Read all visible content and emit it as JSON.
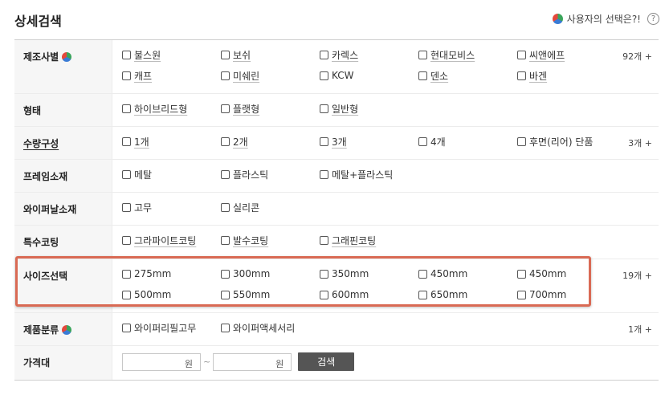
{
  "header": {
    "title": "상세검색",
    "user_choice_label": "사용자의 선택은?!",
    "help_glyph": "?"
  },
  "filters": [
    {
      "label": "제조사별",
      "options": [
        "불스원",
        "보쉬",
        "카렉스",
        "현대모비스",
        "씨앤에프",
        "캐프",
        "미쉐린",
        "KCW",
        "덴소",
        "바겐"
      ],
      "count": "92개 +"
    },
    {
      "label": "형태",
      "options": [
        "하이브리드형",
        "플랫형",
        "일반형"
      ],
      "count": ""
    },
    {
      "label": "수량구성",
      "options": [
        "1개",
        "2개",
        "3개",
        "4개",
        "후면(리어) 단품"
      ],
      "count": "3개 +"
    },
    {
      "label": "프레임소재",
      "options": [
        "메탈",
        "플라스틱",
        "메탈+플라스틱"
      ],
      "count": ""
    },
    {
      "label": "와이퍼날소재",
      "options": [
        "고무",
        "실리콘"
      ],
      "count": ""
    },
    {
      "label": "특수코팅",
      "options": [
        "그라파이트코팅",
        "발수코팅",
        "그래핀코팅"
      ],
      "count": ""
    },
    {
      "label": "사이즈선택",
      "options": [
        "275mm",
        "300mm",
        "350mm",
        "450mm",
        "450mm",
        "500mm",
        "550mm",
        "600mm",
        "650mm",
        "700mm"
      ],
      "count": "19개 +"
    },
    {
      "label": "제품분류",
      "options": [
        "와이퍼리필고무",
        "와이퍼액세서리"
      ],
      "count": "1개 +"
    }
  ],
  "price": {
    "label": "가격대",
    "min_unit": "원",
    "max_unit": "원",
    "separator": "~",
    "search_label": "검색"
  },
  "colors": {
    "highlight": "#d96a54",
    "search_button": "#555555"
  }
}
